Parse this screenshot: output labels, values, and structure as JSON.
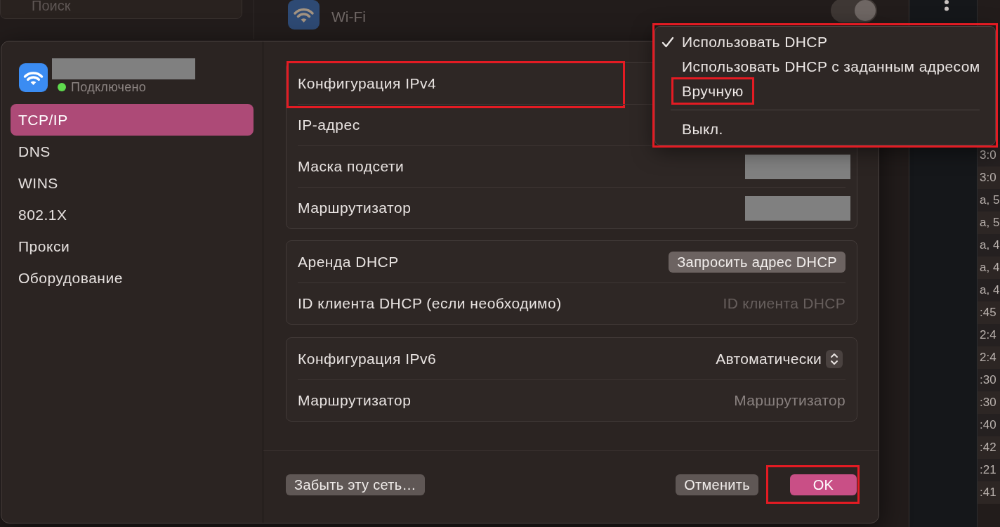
{
  "settings_window": {
    "search": {
      "placeholder": "Поиск"
    },
    "header": {
      "title": "Wi-Fi",
      "toggle": {
        "on": true
      }
    }
  },
  "dialog": {
    "network": {
      "status": "Подключено"
    },
    "sidebar": {
      "items": [
        {
          "label": "TCP/IP",
          "selected": true
        },
        {
          "label": "DNS",
          "selected": false
        },
        {
          "label": "WINS",
          "selected": false
        },
        {
          "label": "802.1X",
          "selected": false
        },
        {
          "label": "Прокси",
          "selected": false
        },
        {
          "label": "Оборудование",
          "selected": false
        }
      ]
    },
    "sections": [
      {
        "rows": [
          {
            "kind": "plain",
            "label": "Конфигурация IPv4",
            "highlighted": true
          },
          {
            "kind": "plain",
            "label": "IP-адрес",
            "highlighted": false
          },
          {
            "kind": "redacted",
            "label": "Маска подсети",
            "highlighted": false
          },
          {
            "kind": "redacted",
            "label": "Маршрутизатор",
            "highlighted": false
          }
        ]
      },
      {
        "rows": [
          {
            "kind": "button",
            "label": "Аренда DHCP",
            "button": "Запросить адрес DHCP",
            "highlighted": false
          },
          {
            "kind": "field",
            "label": "ID клиента DHCP (если необходимо)",
            "placeholder": "ID клиента DHCP",
            "highlighted": false
          }
        ]
      },
      {
        "rows": [
          {
            "kind": "popup",
            "label": "Конфигурация IPv6",
            "value": "Автоматически",
            "highlighted": false
          },
          {
            "kind": "field",
            "label": "Маршрутизатор",
            "placeholder": "Маршрутизатор",
            "highlighted": false
          }
        ]
      }
    ],
    "footer": {
      "left_buttons": [
        {
          "label": "Забыть эту сеть…",
          "kind": "secondary",
          "highlighted": false
        }
      ],
      "right_buttons": [
        {
          "label": "Отменить",
          "kind": "secondary",
          "highlighted": false
        },
        {
          "label": "OK",
          "kind": "primary",
          "highlighted": true
        }
      ]
    }
  },
  "popup_menu": {
    "highlighted": true,
    "groups": [
      {
        "items": [
          {
            "label": "Использовать DHCP",
            "checked": true,
            "highlighted": false
          },
          {
            "label": "Использовать DHCP с заданным адресом",
            "checked": false,
            "highlighted": false
          },
          {
            "label": "Вручную",
            "checked": false,
            "highlighted": true
          }
        ]
      },
      {
        "items": [
          {
            "label": "Выкл.",
            "checked": false,
            "highlighted": false
          }
        ]
      }
    ]
  },
  "log_list": {
    "rows": [
      "3:0",
      "3:0",
      "а, 5",
      "а, 5",
      "а, 4",
      "а, 4",
      "а, 4",
      ":45",
      "2:4",
      "2:4",
      ":30",
      ":30",
      ":40",
      ":42",
      ":21",
      ":41"
    ]
  }
}
